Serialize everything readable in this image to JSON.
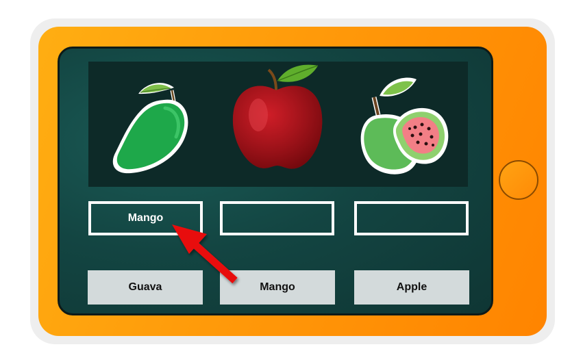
{
  "fruits": [
    "mango",
    "apple",
    "guava"
  ],
  "slots": [
    {
      "label": "Mango"
    },
    {
      "label": ""
    },
    {
      "label": ""
    }
  ],
  "choices": [
    "Guava",
    "Mango",
    "Apple"
  ],
  "icons": {
    "arrow": "red-arrow-icon",
    "home": "home-button-icon"
  },
  "colors": {
    "tablet": "#ff9a0a",
    "screen": "#134542",
    "arrow": "#e81010",
    "choice_bg": "#d3dadb"
  }
}
